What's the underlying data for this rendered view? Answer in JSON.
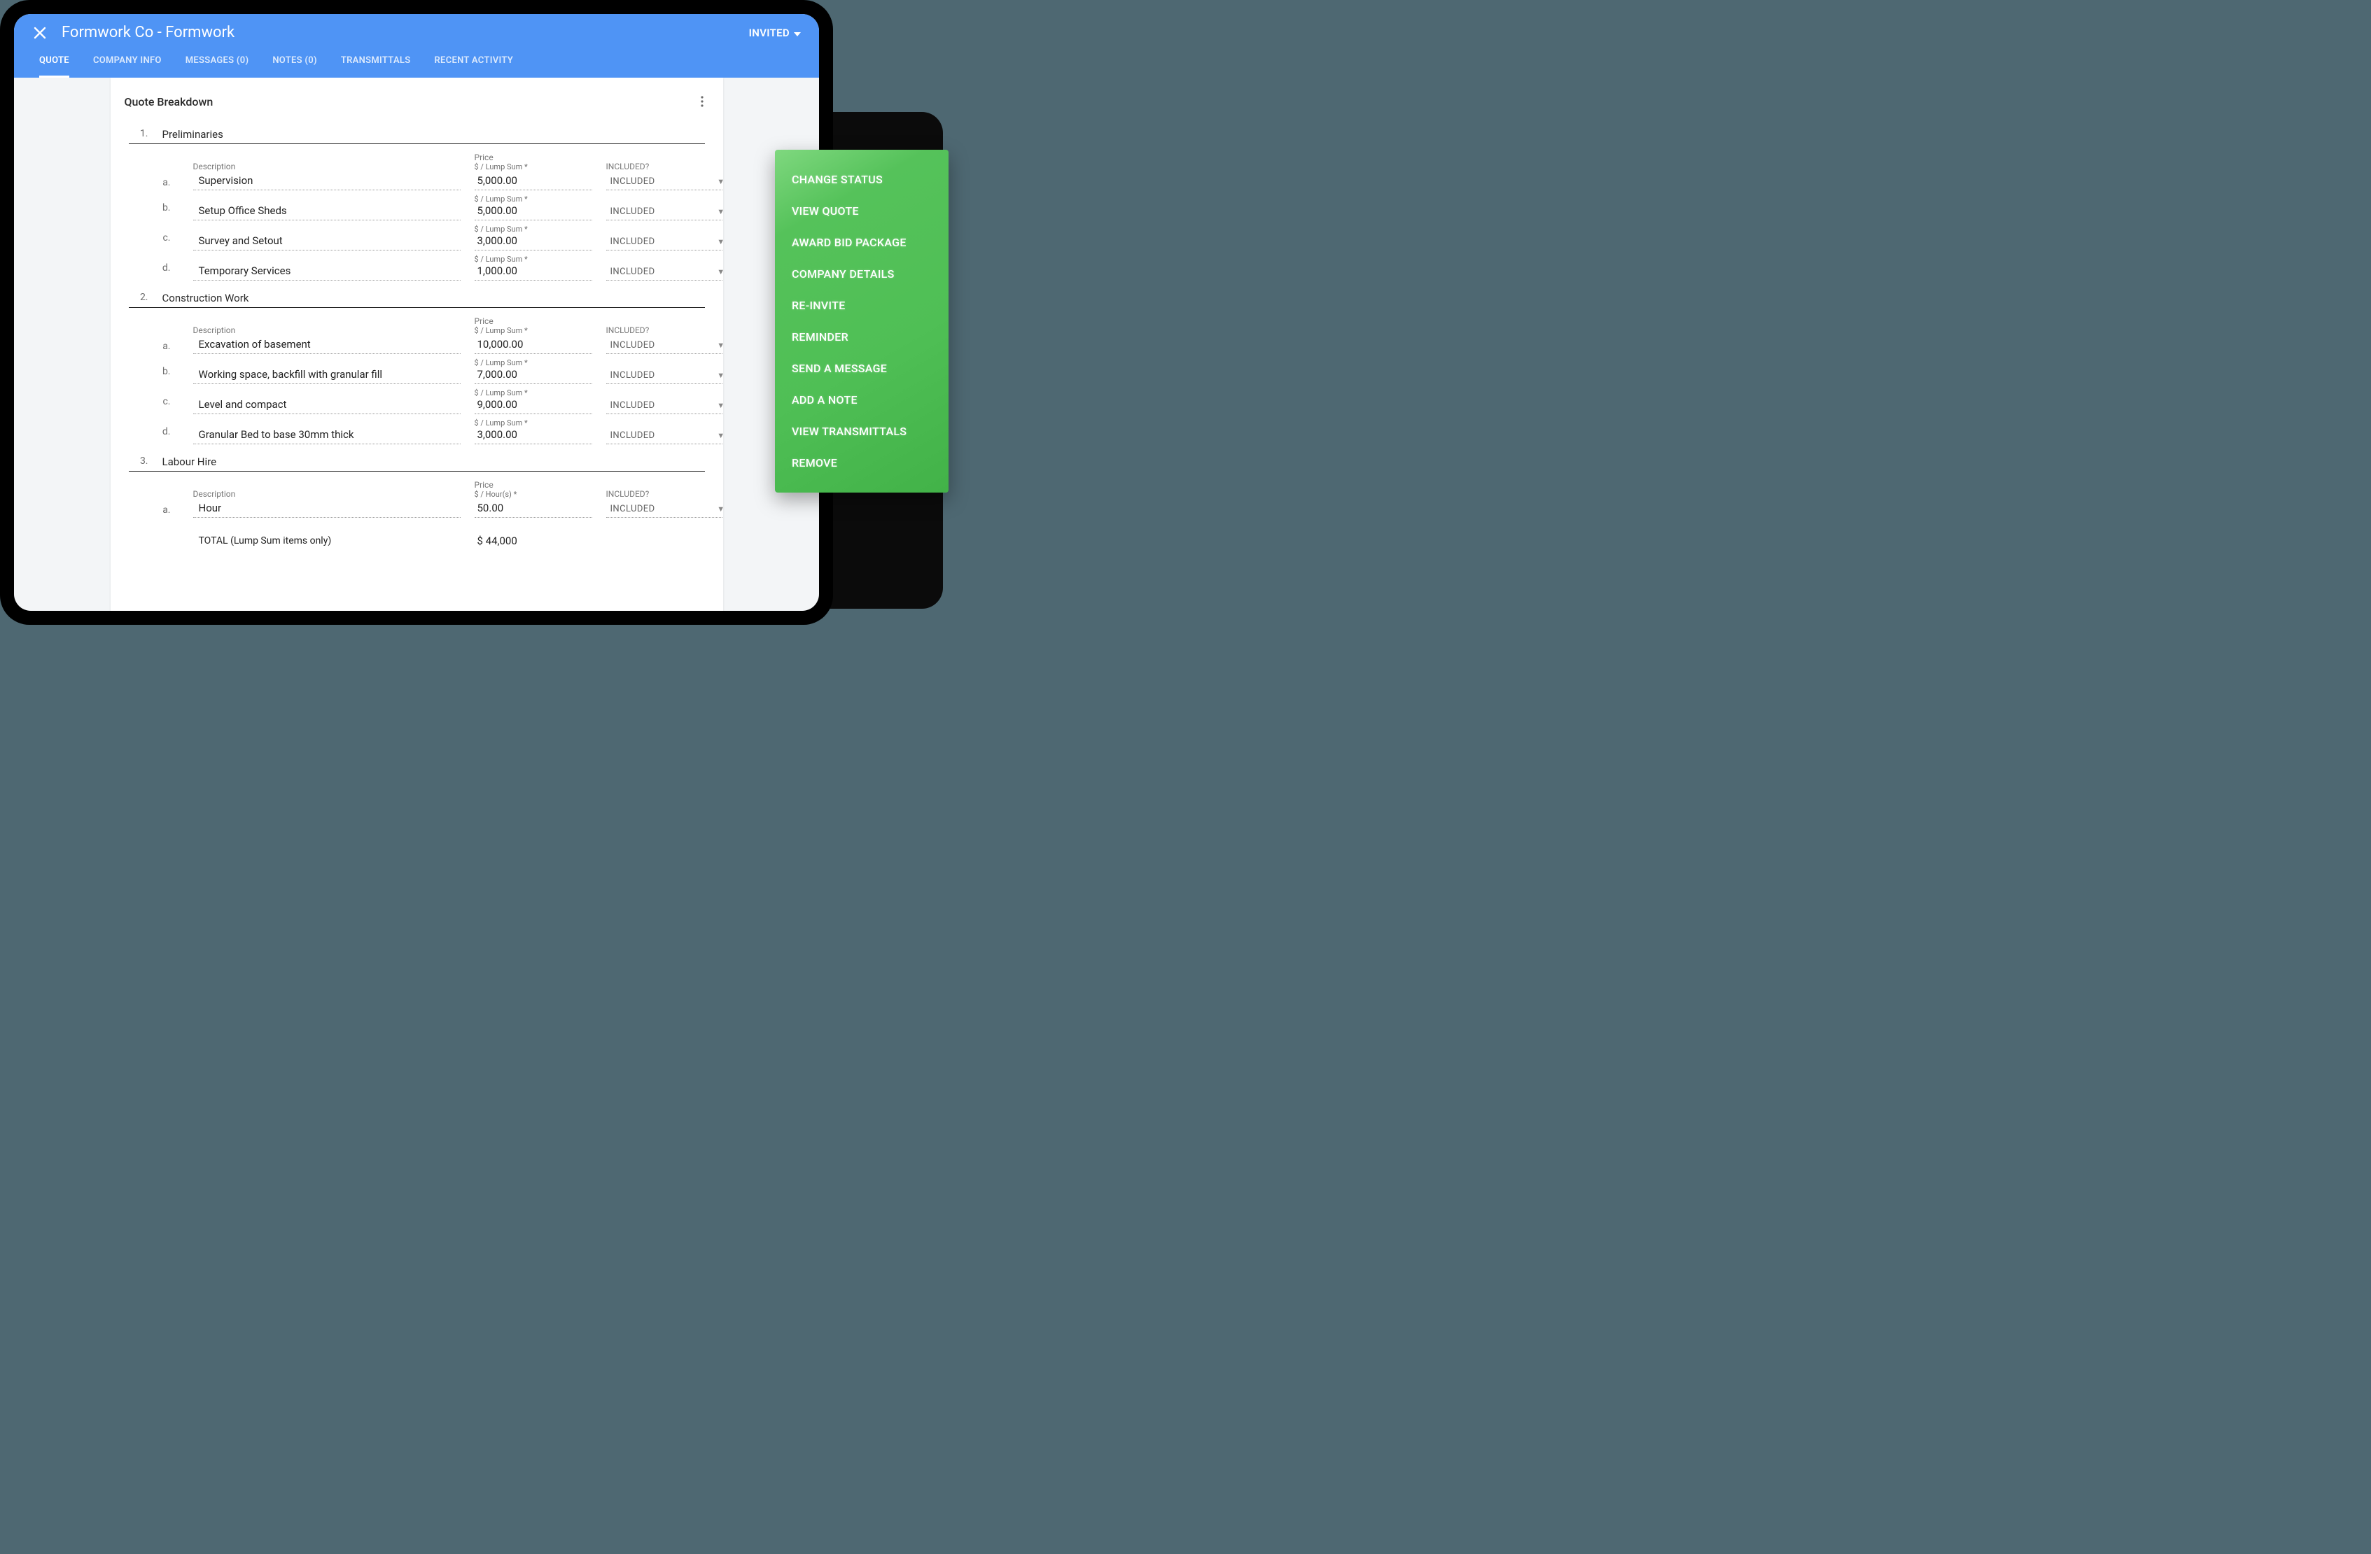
{
  "header": {
    "title": "Formwork Co - Formwork",
    "status_label": "INVITED"
  },
  "tabs": [
    {
      "label": "QUOTE",
      "active": true
    },
    {
      "label": "COMPANY INFO",
      "active": false
    },
    {
      "label": "MESSAGES (0)",
      "active": false
    },
    {
      "label": "NOTES (0)",
      "active": false
    },
    {
      "label": "TRANSMITTALS",
      "active": false
    },
    {
      "label": "RECENT ACTIVITY",
      "active": false
    }
  ],
  "card": {
    "title": "Quote Breakdown",
    "col_description": "Description",
    "col_price": "Price",
    "col_included": "INCLUDED?",
    "price_unit_lump": "$ / Lump Sum *",
    "price_unit_hour": "$ / Hour(s) *",
    "included_label": "INCLUDED",
    "total_label": "TOTAL (Lump Sum items only)",
    "total_value": "$  44,000"
  },
  "sections": [
    {
      "num": "1.",
      "title": "Preliminaries",
      "items": [
        {
          "letter": "a.",
          "desc": "Supervision",
          "price": "5,000.00",
          "unit": "$ / Lump Sum *"
        },
        {
          "letter": "b.",
          "desc": "Setup Office Sheds",
          "price": "5,000.00",
          "unit": "$ / Lump Sum *"
        },
        {
          "letter": "c.",
          "desc": "Survey and Setout",
          "price": "3,000.00",
          "unit": "$ / Lump Sum *"
        },
        {
          "letter": "d.",
          "desc": "Temporary Services",
          "price": "1,000.00",
          "unit": "$ / Lump Sum *"
        }
      ]
    },
    {
      "num": "2.",
      "title": "Construction Work",
      "items": [
        {
          "letter": "a.",
          "desc": "Excavation of basement",
          "price": "10,000.00",
          "unit": "$ / Lump Sum *"
        },
        {
          "letter": "b.",
          "desc": "Working space, backfill with granular fill",
          "price": "7,000.00",
          "unit": "$ / Lump Sum *"
        },
        {
          "letter": "c.",
          "desc": "Level and compact",
          "price": "9,000.00",
          "unit": "$ / Lump Sum *"
        },
        {
          "letter": "d.",
          "desc": "Granular Bed to base 30mm thick",
          "price": "3,000.00",
          "unit": "$ / Lump Sum *"
        }
      ]
    },
    {
      "num": "3.",
      "title": "Labour Hire",
      "items": [
        {
          "letter": "a.",
          "desc": "Hour",
          "price": "50.00",
          "unit": "$ / Hour(s) *"
        }
      ]
    }
  ],
  "menu": [
    "CHANGE STATUS",
    "VIEW QUOTE",
    "AWARD BID PACKAGE",
    "COMPANY DETAILS",
    "RE-INVITE",
    "REMINDER",
    "SEND A MESSAGE",
    "ADD A NOTE",
    "VIEW TRANSMITTALS",
    "REMOVE"
  ]
}
